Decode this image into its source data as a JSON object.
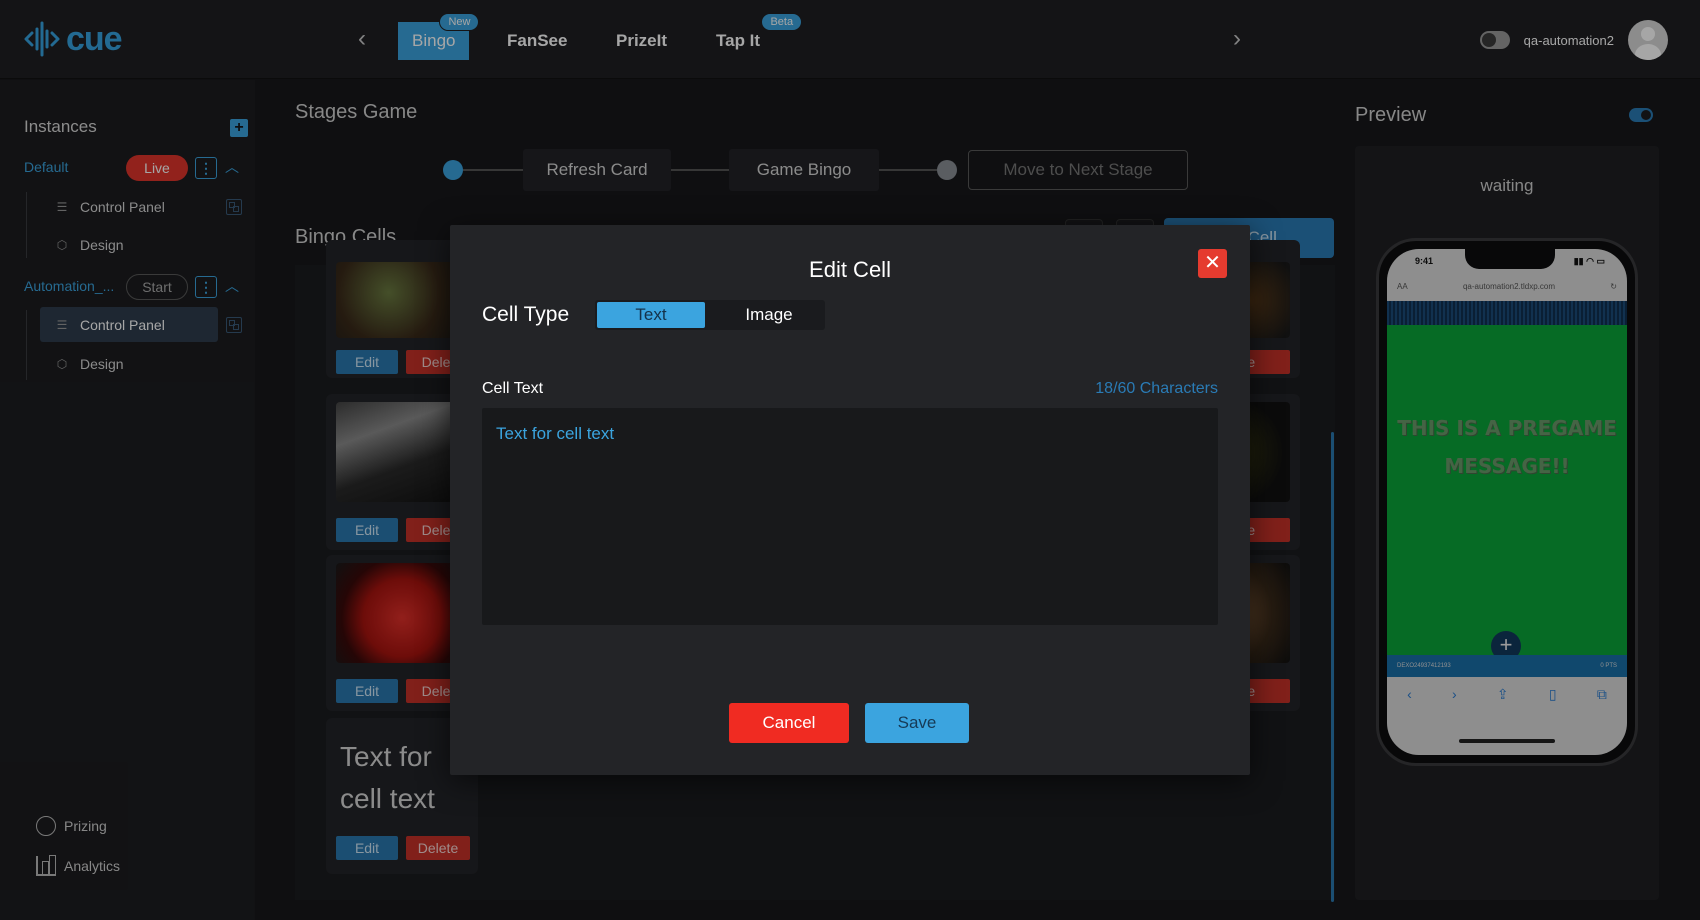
{
  "app": {
    "logo_text": "cue"
  },
  "nav": {
    "tabs": [
      {
        "label": "Bingo",
        "badge": "New",
        "active": true
      },
      {
        "label": "FanSee",
        "badge": ""
      },
      {
        "label": "PrizeIt",
        "badge": ""
      },
      {
        "label": "Tap It",
        "badge": "Beta"
      }
    ],
    "prev_icon": "chevron-left-icon",
    "next_icon": "chevron-right-icon"
  },
  "user": {
    "name": "qa-automation2"
  },
  "sidebar": {
    "title": "Instances",
    "instances": [
      {
        "name": "Default",
        "status": "Live",
        "items": [
          "Control Panel",
          "Design"
        ]
      },
      {
        "name": "Automation_...",
        "status": "Start",
        "items": [
          "Control Panel",
          "Design"
        ]
      }
    ],
    "bottom": [
      "Prizing",
      "Analytics"
    ]
  },
  "main": {
    "stages_title": "Stages Game",
    "stages": [
      "Refresh Card",
      "Game Bingo"
    ],
    "next_stage_label": "Move to Next Stage",
    "cells_title": "Bingo Cells",
    "new_cell_label": "ew Cell",
    "edit_label": "Edit",
    "delete_label": "Delete",
    "delete_partial": "Delet",
    "delete_right_partial": "elete",
    "text_cell_content": "Text for cell text"
  },
  "modal": {
    "title": "Edit Cell",
    "cell_type_label": "Cell Type",
    "type_options": [
      "Text",
      "Image"
    ],
    "selected_type": "Text",
    "field_label": "Cell Text",
    "char_count": "18/60 Characters",
    "text_value": "Text for cell text",
    "cancel_label": "Cancel",
    "save_label": "Save"
  },
  "preview": {
    "title": "Preview",
    "status": "waiting",
    "phone_time": "9:41",
    "phone_url": "qa-automation2.tldxp.com",
    "phone_aa": "AA",
    "pregame_message": "THIS IS A PREGAME MESSAGE!!",
    "footer_left": "DEXO24937412193",
    "footer_right": "0 PTS"
  },
  "colors": {
    "accent": "#3ba4df",
    "danger": "#e0352b",
    "green": "#0aa53a"
  }
}
